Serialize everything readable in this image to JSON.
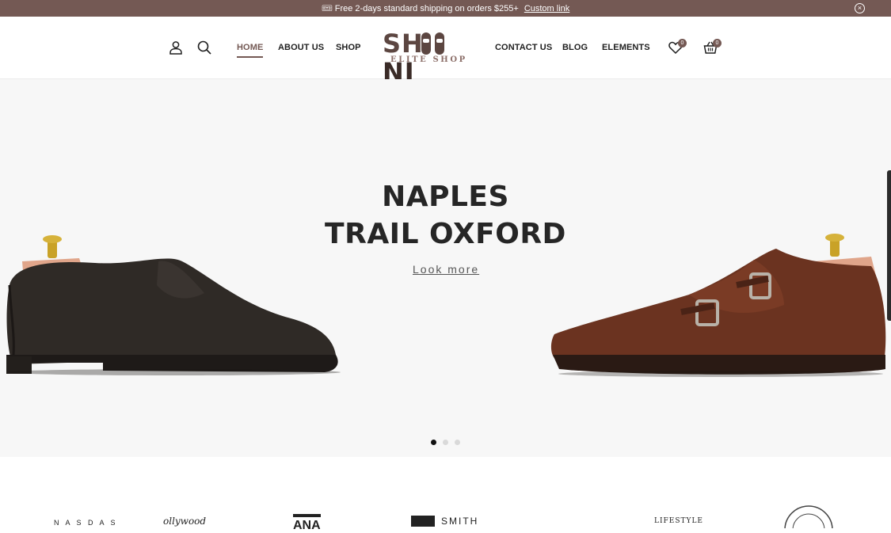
{
  "announcement": {
    "icon": "ticket-icon",
    "message": "🎟 Free 2-days standard shipping on orders $255+",
    "link_label": "Custom link"
  },
  "header": {
    "nav_left": [
      "HOME",
      "ABOUT US",
      "SHOP"
    ],
    "nav_right": [
      "CONTACT US",
      "BLOG",
      "ELEMENTS"
    ],
    "active_item": "HOME",
    "logo": {
      "word_first": "SH",
      "word_last": "NI",
      "tagline": "ELITE SHOP"
    },
    "wishlist_count": "0",
    "cart_count": "0"
  },
  "hero": {
    "title_line1": "NAPLES",
    "title_line2": "TRAIL OXFORD",
    "cta_label": "Look more",
    "slide_count": 3,
    "active_slide": 1
  },
  "brands": {
    "items": [
      "N A S D A S",
      "ollywood",
      "ANA",
      "SMITH",
      "LIFESTYLE"
    ]
  },
  "colors": {
    "accent": "#745954",
    "hero_bg": "#f7f7f7",
    "text_dark": "#262626"
  }
}
